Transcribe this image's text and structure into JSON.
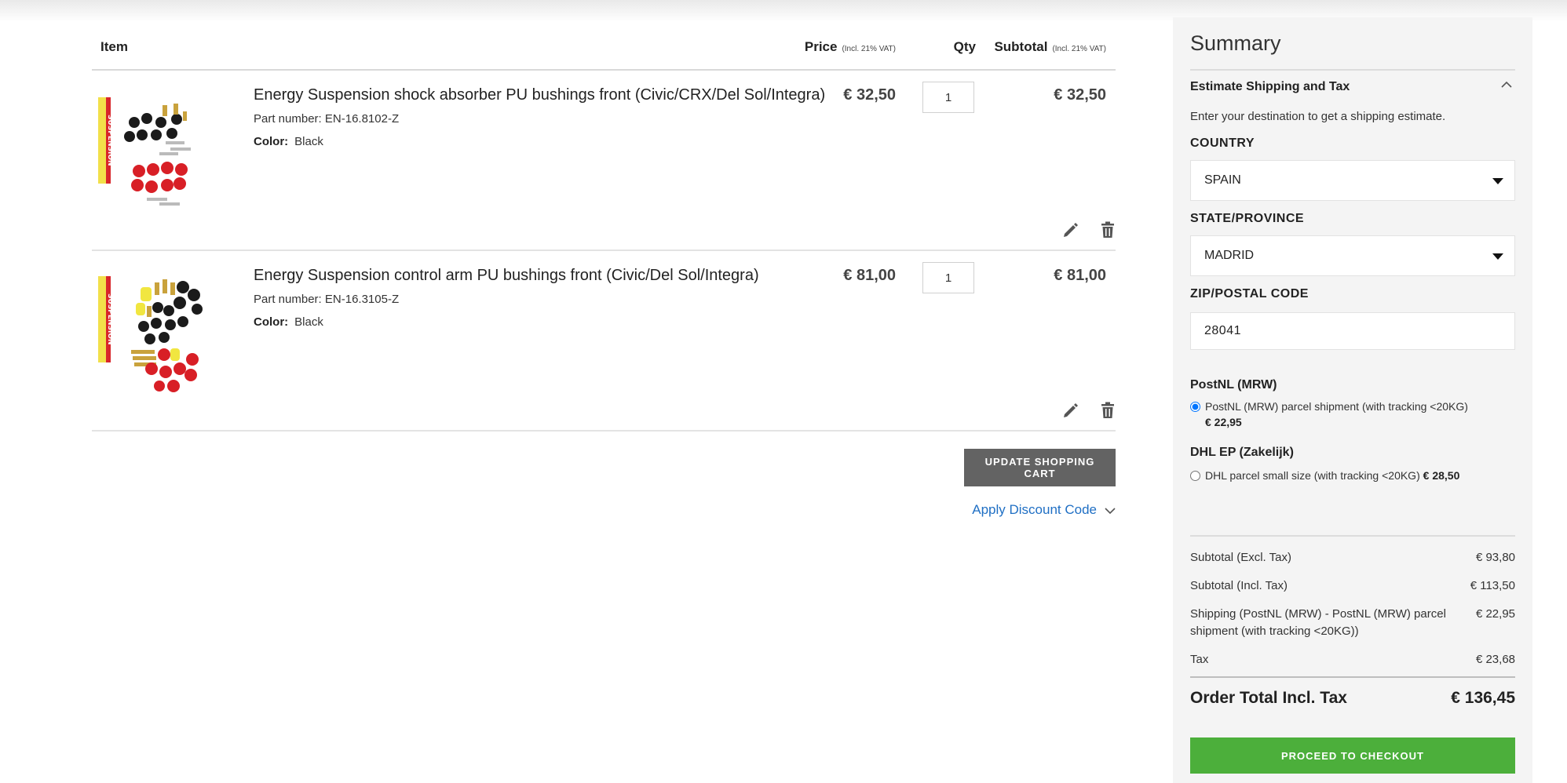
{
  "cart": {
    "headers": {
      "item": "Item",
      "price": "Price",
      "price_note": "(Incl. 21% VAT)",
      "qty": "Qty",
      "subtotal": "Subtotal",
      "subtotal_note": "(Incl. 21% VAT)"
    },
    "items": [
      {
        "name": "Energy Suspension shock absorber PU bushings front (Civic/CRX/Del Sol/Integra)",
        "part_label": "Part number:",
        "part_number": "EN-16.8102-Z",
        "color_label": "Color:",
        "color": "Black",
        "price": "€ 32,50",
        "qty": "1",
        "subtotal": "€ 32,50"
      },
      {
        "name": "Energy Suspension control arm PU bushings front (Civic/Del Sol/Integra)",
        "part_label": "Part number:",
        "part_number": "EN-16.3105-Z",
        "color_label": "Color:",
        "color": "Black",
        "price": "€ 81,00",
        "qty": "1",
        "subtotal": "€ 81,00"
      }
    ],
    "update_button": "UPDATE SHOPPING CART",
    "discount_link": "Apply Discount Code"
  },
  "summary": {
    "title": "Summary",
    "estimate": {
      "title": "Estimate Shipping and Tax",
      "description": "Enter your destination to get a shipping estimate.",
      "country_label": "COUNTRY",
      "country_value": "SPAIN",
      "state_label": "STATE/PROVINCE",
      "state_value": "MADRID",
      "zip_label": "ZIP/POSTAL CODE",
      "zip_value": "28041"
    },
    "shipping_methods": [
      {
        "carrier": "PostNL (MRW)",
        "option": "PostNL (MRW) parcel shipment (with tracking <20KG)",
        "price": "€ 22,95",
        "selected": true
      },
      {
        "carrier": "DHL EP (Zakelijk)",
        "option": "DHL parcel small size (with tracking <20KG)",
        "price": "€ 28,50",
        "selected": false
      }
    ],
    "totals": {
      "subtotal_excl_label": "Subtotal (Excl. Tax)",
      "subtotal_excl": "€ 93,80",
      "subtotal_incl_label": "Subtotal (Incl. Tax)",
      "subtotal_incl": "€ 113,50",
      "shipping_label": "Shipping (PostNL (MRW) - PostNL (MRW) parcel shipment (with tracking <20KG))",
      "shipping": "€ 22,95",
      "tax_label": "Tax",
      "tax": "€ 23,68",
      "order_total_label": "Order Total Incl. Tax",
      "order_total": "€ 136,45"
    },
    "checkout_button": "PROCEED TO CHECKOUT"
  },
  "icons": {
    "edit": "pencil-icon",
    "delete": "trash-icon",
    "collapse": "chevron-up-icon",
    "expand": "chevron-down-icon",
    "select_caret": "caret-down-icon"
  },
  "colors": {
    "accent_link": "#1f6fc4",
    "checkout_green": "#4caf3b",
    "update_gray": "#636363",
    "sidebar_bg": "#f4f4f4"
  }
}
